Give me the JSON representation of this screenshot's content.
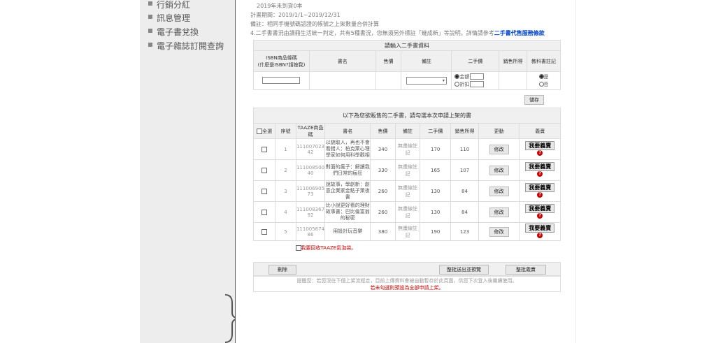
{
  "sidebar": {
    "items": [
      {
        "label": "行銷分紅"
      },
      {
        "label": "訊息管理"
      },
      {
        "label": "電子書兌換"
      },
      {
        "label": "電子雜誌訂閱查詢"
      }
    ]
  },
  "info": {
    "line1": "2019年未到貨0本",
    "line2": "計畫期間：2019/1/1~2019/12/31",
    "line3": "備註：相同手機號碼認證的帳號之上架數量合併計算",
    "line4": "4.二手書書況由讀冊生活統一判定，共有5種書況，您無須另外標註「幾成新」等說明。詳情請參考",
    "line4_link": "二手書代售服務條款"
  },
  "entry_form": {
    "title": "請輸入二手書資料",
    "headers": [
      "ISBN商品條碼\n(什麼是ISBN?請按我)",
      "書名",
      "售價",
      "備註",
      "二手價",
      "銷售所得",
      "教科書註記"
    ],
    "radio_amount": "金額",
    "radio_discount": "折扣",
    "radio_yes": "是",
    "radio_no": "否",
    "add_button": "儲存"
  },
  "list": {
    "title": "以下為您欲販售的二手書，請勾選本次申請上架的書",
    "headers": {
      "select_all": "全選",
      "no": "序號",
      "code": "TAAZE商品碼",
      "name": "書名",
      "price": "售價",
      "note": "備註",
      "used_price": "二手價",
      "income": "銷售所得",
      "edit": "更動",
      "sell": "義賣"
    },
    "rows": [
      {
        "no": "1",
        "code": "11100702342",
        "name": "以貌取人，再也不會看錯人：柏克萊心理學家如何用科學觀相",
        "price": "340",
        "note": "無畫線註記",
        "used_price": "170",
        "income": "110"
      },
      {
        "no": "2",
        "code": "11100850040",
        "name": "對面的瘋子：解讀我們日常的瘋狂",
        "price": "330",
        "note": "無畫線註記",
        "used_price": "165",
        "income": "107"
      },
      {
        "no": "3",
        "code": "11100690573",
        "name": "說故事，學創新：創意企業家金點子萊夜書",
        "price": "260",
        "note": "無畫線註記",
        "used_price": "130",
        "income": "84"
      },
      {
        "no": "4",
        "code": "11100836792",
        "name": "比小說更好看的理財故事書：巴比倫富翁的秘密",
        "price": "260",
        "note": "無畫線註記",
        "used_price": "130",
        "income": "84"
      },
      {
        "no": "5",
        "code": "11100567486",
        "name": "用設計玩音樂",
        "price": "380",
        "note": "無畫線註記",
        "used_price": "190",
        "income": "123"
      }
    ],
    "edit_label": "修改",
    "sell_label": "我要義賣",
    "recycle_label": "我要回收TAAZE氣泡袋。",
    "delete_button": "刪除",
    "batch_submit_button": "整批送出並預覽",
    "batch_sell_button": "整批義賣",
    "reminder": "提醒您：若您沒往下個上架流程走，目前上傳資料會被自動暫存於此頁面，供您下次登入後繼續使用。",
    "reminder_red": "若未勾選則預設為全部申請上架。"
  }
}
